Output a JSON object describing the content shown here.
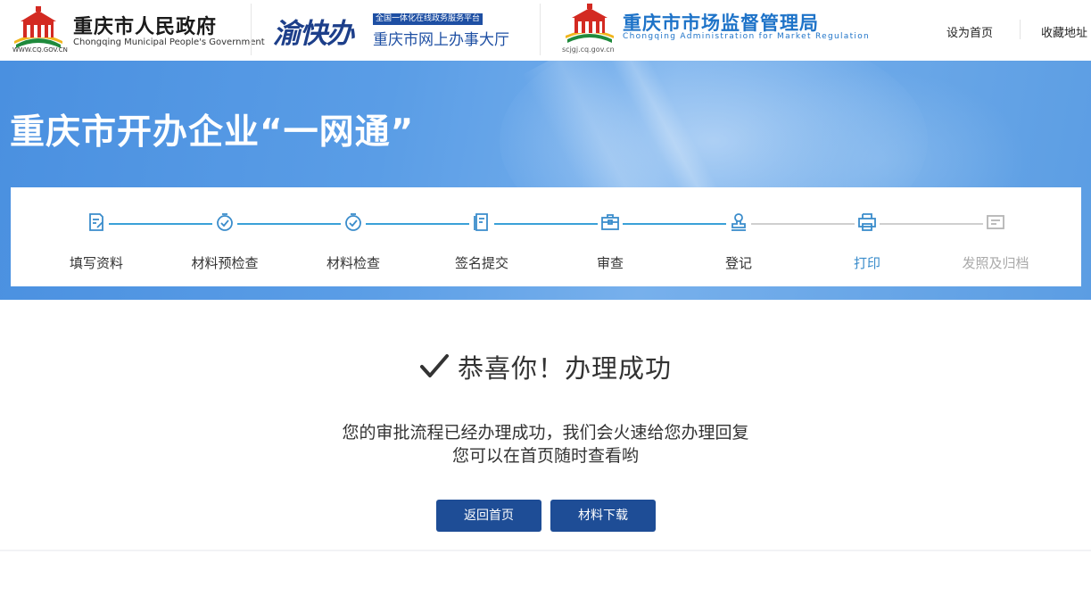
{
  "header": {
    "logo_gov": {
      "title": "重庆市人民政府",
      "subtitle": "Chongqing Municipal People's Government",
      "url": "WWW.CQ.GOV.CN",
      "icon": "government-emblem-icon"
    },
    "logo_yukuaiban": {
      "brand": "渝快办",
      "tag": "全国一体化在线政务服务平台",
      "title": "重庆市网上办事大厅"
    },
    "logo_market": {
      "title": "重庆市市场监督管理局",
      "subtitle": "Chongqing  Administration  for  Market  Regulation",
      "url": "scjgj.cq.gov.cn",
      "icon": "market-regulation-emblem-icon"
    },
    "links": {
      "set_home": "设为首页",
      "bookmark": "收藏地址"
    }
  },
  "banner": {
    "title": "重庆市开办企业“一网通”"
  },
  "steps": [
    {
      "label": "填写资料",
      "icon": "form-edit-icon",
      "status": "done"
    },
    {
      "label": "材料预检查",
      "icon": "check-clock-icon",
      "status": "done"
    },
    {
      "label": "材料检查",
      "icon": "check-clock-icon",
      "status": "done"
    },
    {
      "label": "签名提交",
      "icon": "sign-document-icon",
      "status": "done"
    },
    {
      "label": "审查",
      "icon": "briefcase-icon",
      "status": "done"
    },
    {
      "label": "登记",
      "icon": "stamp-icon",
      "status": "done"
    },
    {
      "label": "打印",
      "icon": "printer-icon",
      "status": "current"
    },
    {
      "label": "发照及归档",
      "icon": "license-card-icon",
      "status": "todo"
    }
  ],
  "success": {
    "title": "恭喜你！办理成功",
    "icon": "checkmark-icon",
    "message_line1": "您的审批流程已经办理成功，我们会火速给您办理回复",
    "message_line2": "您可以在首页随时查看哟",
    "buttons": {
      "home": "返回首页",
      "download": "材料下载"
    }
  },
  "colors": {
    "primary_button": "#1e4d96",
    "step_done_line": "#3aa1d8",
    "step_current": "#3a8ccb",
    "step_todo": "#aaaaaa",
    "banner": "#4a90e0"
  }
}
